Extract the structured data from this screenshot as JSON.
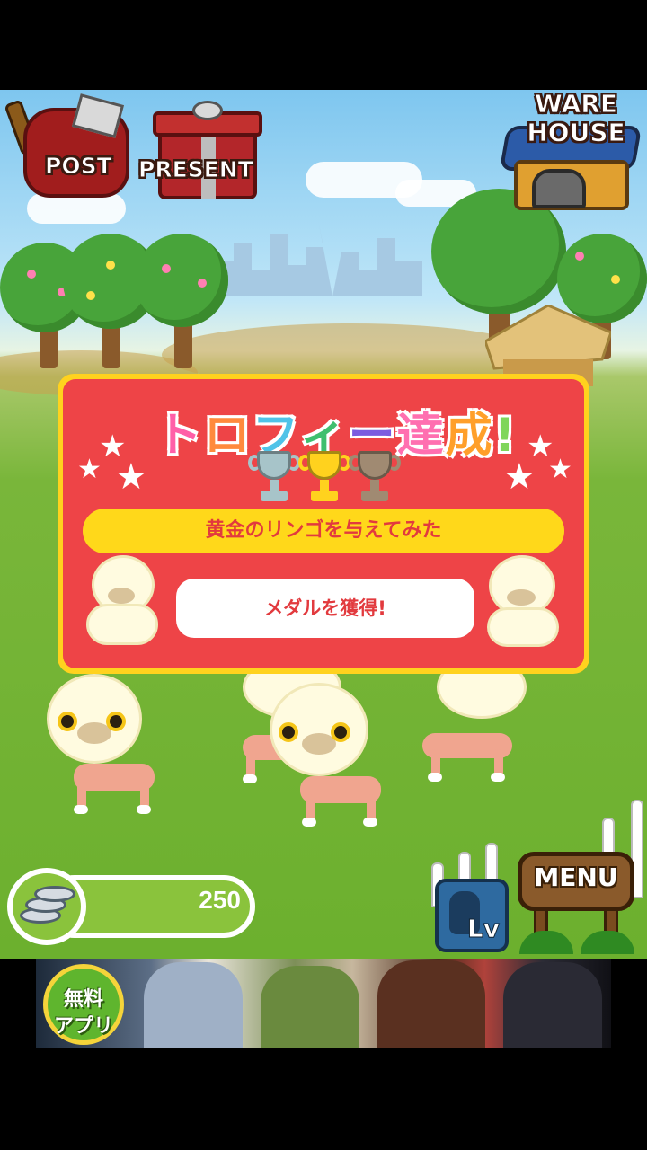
{
  "hud": {
    "post_label": "POST",
    "present_label": "PRESENT",
    "warehouse_line1": "WARE",
    "warehouse_line2": "HOUSE",
    "coins": "250",
    "level_label": "Lv",
    "menu_label": "MENU"
  },
  "dialog": {
    "title_chars": [
      "ト",
      "ロ",
      "フ",
      "ィ",
      "ー",
      "達",
      "成",
      "!"
    ],
    "title_colors": [
      "#ff5fa8",
      "#ff8a3d",
      "#4fc3e8",
      "#3fbf6e",
      "#7c5ce0",
      "#ff6fb0",
      "#ff9f2a",
      "#7fd65a"
    ],
    "trophies": [
      {
        "name": "silver",
        "color": "#a7c4c9"
      },
      {
        "name": "gold",
        "color": "#ffd21e"
      },
      {
        "name": "bronze",
        "color": "#a08a72"
      }
    ],
    "achievement": "黄金のリンゴを与えてみた",
    "button_label": "メダルを獲得!"
  },
  "ad": {
    "badge_line1": "無料",
    "badge_line2": "アプリ"
  }
}
